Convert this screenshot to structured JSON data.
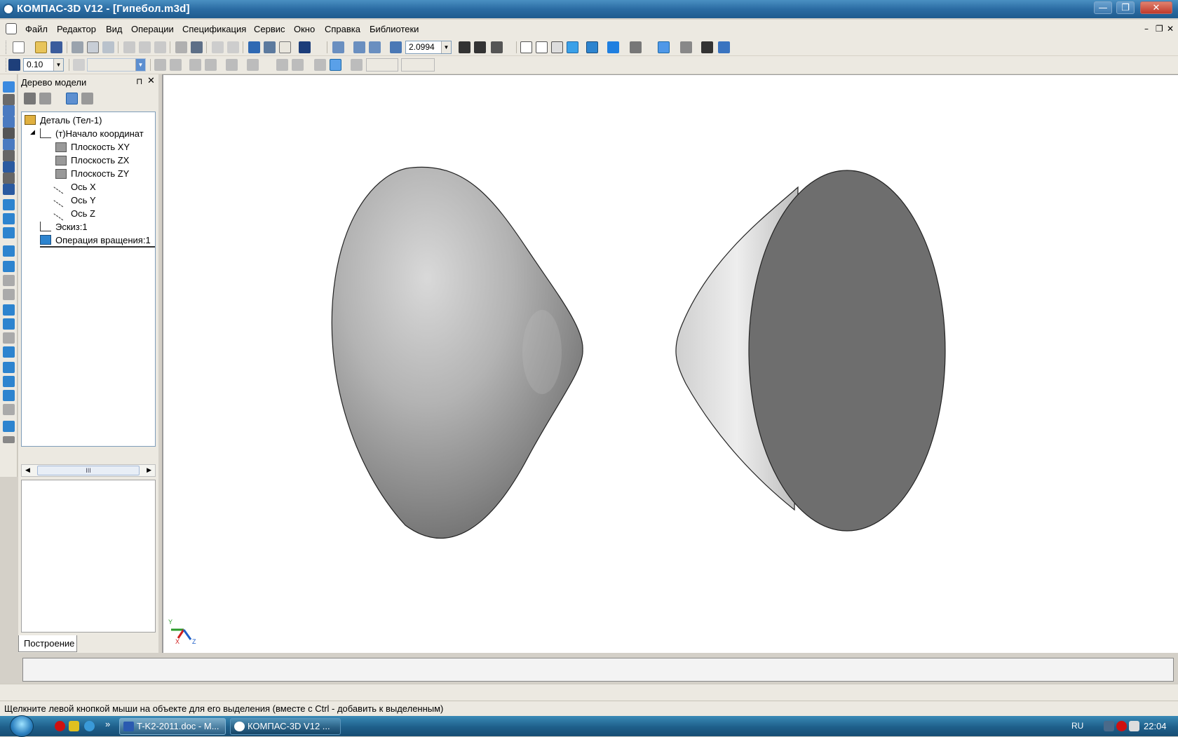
{
  "window": {
    "title": "КОМПАС-3D V12 - [Гипебол.m3d]",
    "buttons": {
      "minimize": "—",
      "maximize": "❐",
      "close": "✕"
    }
  },
  "menu": {
    "items": [
      "Файл",
      "Редактор",
      "Вид",
      "Операции",
      "Спецификация",
      "Сервис",
      "Окно",
      "Справка",
      "Библиотеки"
    ],
    "mdi_controls": [
      "–",
      "❐",
      "✕"
    ]
  },
  "toolbar1": {
    "zoom_value": "2.0994"
  },
  "toolbar2": {
    "step_value": "0.10"
  },
  "tree_panel": {
    "title": "Дерево модели",
    "pin": "⊓",
    "close": "✕",
    "items": [
      {
        "label": "Деталь (Тел-1)",
        "icon": "part-icon"
      },
      {
        "label": "(т)Начало координат",
        "icon": "origin-icon"
      },
      {
        "label": "Плоскость XY",
        "icon": "plane-icon"
      },
      {
        "label": "Плоскость ZX",
        "icon": "plane-icon"
      },
      {
        "label": "Плоскость ZY",
        "icon": "plane-icon"
      },
      {
        "label": "Ось X",
        "icon": "axis-icon"
      },
      {
        "label": "Ось Y",
        "icon": "axis-icon"
      },
      {
        "label": "Ось Z",
        "icon": "axis-icon"
      },
      {
        "label": "Эскиз:1",
        "icon": "sketch-icon"
      },
      {
        "label": "Операция вращения:1",
        "icon": "revolve-icon"
      }
    ],
    "scroll_thumb": "III",
    "tab_label": "Построение"
  },
  "triad": {
    "x": "X",
    "y": "Y",
    "z": "Z"
  },
  "status": {
    "message": "Щелкните левой кнопкой мыши на объекте для его выделения (вместе с Ctrl - добавить к выделенным)"
  },
  "taskbar": {
    "more": "»",
    "tasks": [
      {
        "label": "T-K2-2011.doc - M...",
        "icon": "word-icon",
        "active": false
      },
      {
        "label": "КОМПАС-3D V12 ...",
        "icon": "kompas-icon",
        "active": true
      }
    ],
    "language": "RU",
    "clock": "22:04"
  }
}
